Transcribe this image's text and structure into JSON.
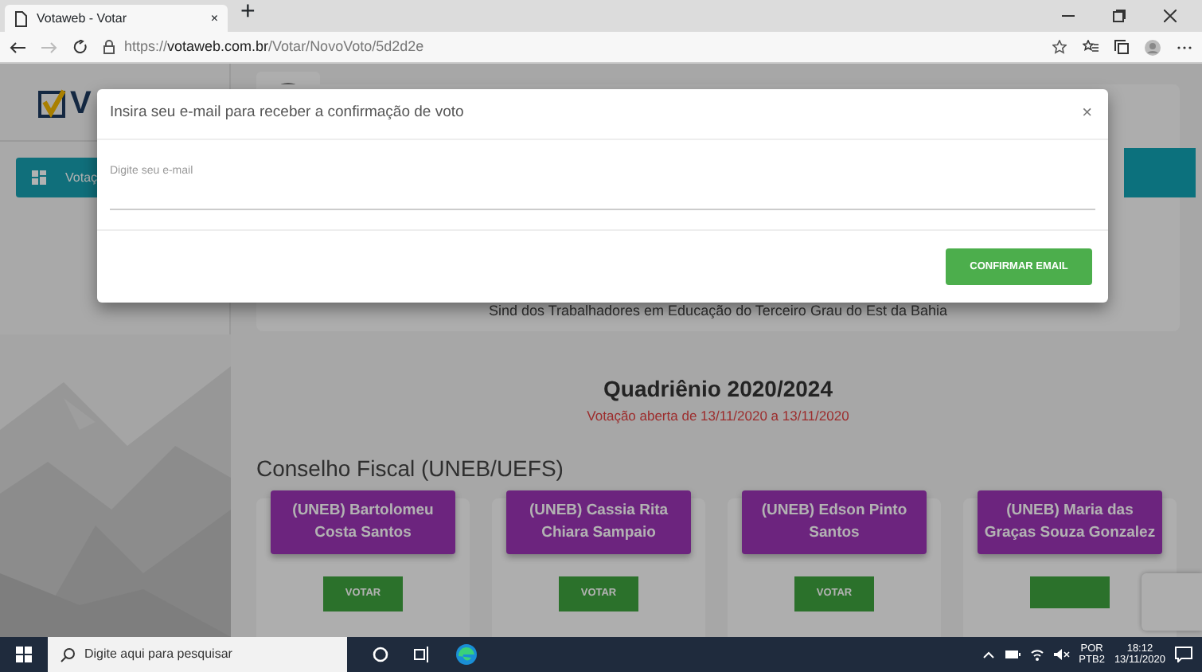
{
  "browser": {
    "tab_title": "Votaweb - Votar",
    "tab_close": "×",
    "new_tab": "+",
    "url": "https://**votaweb.com.br**/Votar/NovoVoto/5d2d2e"
  },
  "sidebar": {
    "logo_text": "V",
    "items": [
      {
        "label": "Votaç",
        "selected": true
      }
    ]
  },
  "organization": {
    "name": "Sind dos Trabalhadores em Educação do Terceiro Grau do Est da Bahia"
  },
  "election": {
    "title": "Quadriênio 2020/2024",
    "period": "Votação aberta de 13/11/2020 a 13/11/2020"
  },
  "section": {
    "title": "Conselho Fiscal (UNEB/UEFS)",
    "candidates": [
      {
        "name": "(UNEB) Bartolomeu Costa Santos",
        "button": "VOTAR"
      },
      {
        "name": "(UNEB) Cassia Rita Chiara Sampaio",
        "button": "VOTAR"
      },
      {
        "name": "(UNEB) Edson Pinto Santos",
        "button": "VOTAR"
      },
      {
        "name": "(UNEB) Maria das Graças Souza Gonzalez"
      }
    ]
  },
  "modal": {
    "title": "Insira seu e-mail para receber a confirmação de voto",
    "close": "×",
    "placeholder": "Digite seu e-mail",
    "button": "CONFIRMAR EMAIL"
  },
  "taskbar": {
    "search_placeholder": "Digite aqui para pesquisar",
    "language": "POR",
    "layout": "PTB2",
    "time": "18:12",
    "date": "13/11/2020"
  }
}
